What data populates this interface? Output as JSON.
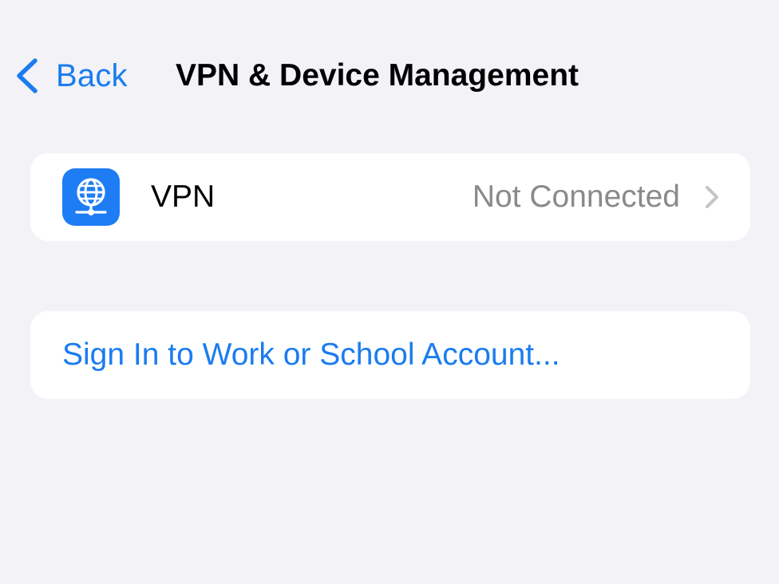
{
  "nav": {
    "back_label": "Back",
    "title": "VPN & Device Management",
    "back_icon": "chevron-left-icon"
  },
  "vpn_row": {
    "label": "VPN",
    "status": "Not Connected",
    "icon": "vpn-globe-icon",
    "chevron_icon": "chevron-right-icon"
  },
  "account_row": {
    "label": "Sign In to Work or School Account..."
  },
  "colors": {
    "background": "#F2F2F7",
    "card": "#FFFFFF",
    "accent": "#1A7CF0",
    "vpn_icon_bg": "#1E7DF5",
    "secondary_text": "#8A8A8E",
    "chevron": "#C4C4C7"
  }
}
